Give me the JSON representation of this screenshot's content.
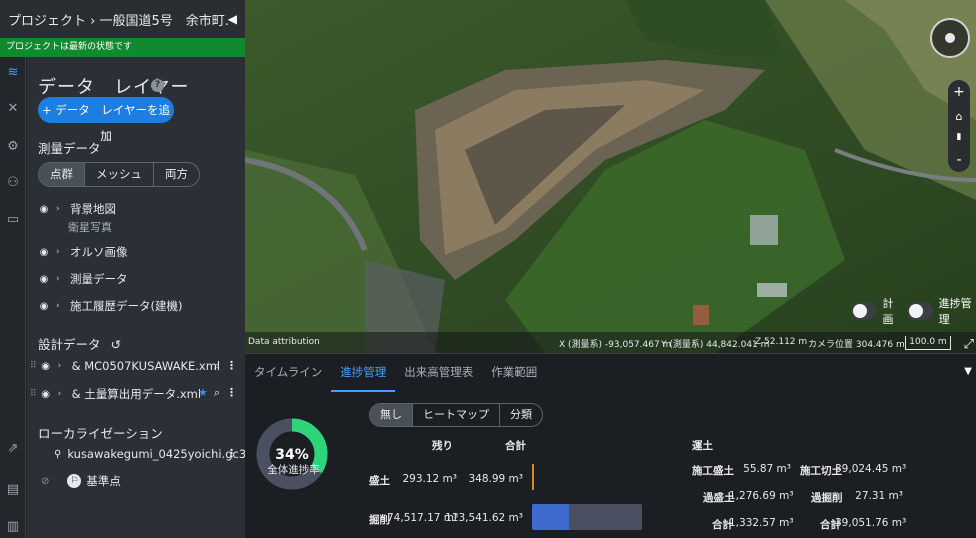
{
  "topbar": {
    "breadcrumb": "プロジェクト › 一般国道5号　余市町... ▾",
    "collapse_icon": "triangle-left-icon"
  },
  "status_message": "プロジェクトは最新の状態です",
  "panel": {
    "title": "データ　レイヤー",
    "add_button": "+ データ　レイヤーを追加",
    "survey_section": "測量データ",
    "survey_tabs": [
      "点群",
      "メッシュ",
      "両方"
    ],
    "survey_selected": 0,
    "layers": [
      {
        "label": "背景地図",
        "sublabel": "衛星写真"
      },
      {
        "label": "オルソ画像"
      },
      {
        "label": "測量データ"
      },
      {
        "label": "施工履歴データ(建機)"
      }
    ],
    "design_section": "設計データ",
    "design_files": [
      {
        "label": "MC0507KUSAWAKE.xml"
      },
      {
        "label": "土量算出用データ.xml"
      }
    ],
    "localization_section": "ローカライゼーション",
    "localization_file": "kusawakegumi_0425yoichi.gc3",
    "reference_point": "基準点"
  },
  "map": {
    "toggle_plan": "計画",
    "toggle_progress": "進捗管理",
    "attribution": "Data attribution",
    "x_readout": "X (測量系) -93,057.467 m",
    "y_readout": "Y (測量系) 44,842.041 m",
    "z_readout": "Z 52.112 m",
    "camera_readout": "カメラ位置 304.476 m",
    "scale": "100.0 m",
    "zoom_in": "+",
    "zoom_out": "-",
    "view_mode_icon": "3d-view-icon"
  },
  "bottom": {
    "tabs": [
      "タイムライン",
      "進捗管理",
      "出来高管理表",
      "作業範囲"
    ],
    "active_tab": 1,
    "progress_percent": "34%",
    "progress_value": 0.34,
    "progress_label": "全体進捗率",
    "view_options": [
      "無し",
      "ヒートマップ",
      "分類"
    ],
    "view_selected": 0,
    "col_remaining": "残り",
    "col_total": "合計",
    "rows": [
      {
        "label": "盛土",
        "remaining": "293.12 m³",
        "total": "348.99 m³",
        "fill_ratio": 0.0
      },
      {
        "label": "掘削",
        "remaining": "74,517.17 m³",
        "total": "113,541.62 m³",
        "fill_ratio": 0.34
      }
    ],
    "transport_header": "運土",
    "summary": [
      {
        "label1": "施工盛土",
        "value1": "55.87 m³",
        "label2": "施工切土",
        "value2": "39,024.45 m³"
      },
      {
        "label1": "過盛土",
        "value1": "1,276.69 m³",
        "label2": "過掘削",
        "value2": "27.31 m³"
      },
      {
        "label1": "合計",
        "value1": "1,332.57 m³",
        "label2": "合計",
        "value2": "39,051.76 m³"
      }
    ]
  },
  "colors": {
    "accent": "#1e7de0",
    "status_green": "#0f8a2e",
    "donut_progress": "#2ed47a",
    "donut_track": "#4a4f62"
  }
}
